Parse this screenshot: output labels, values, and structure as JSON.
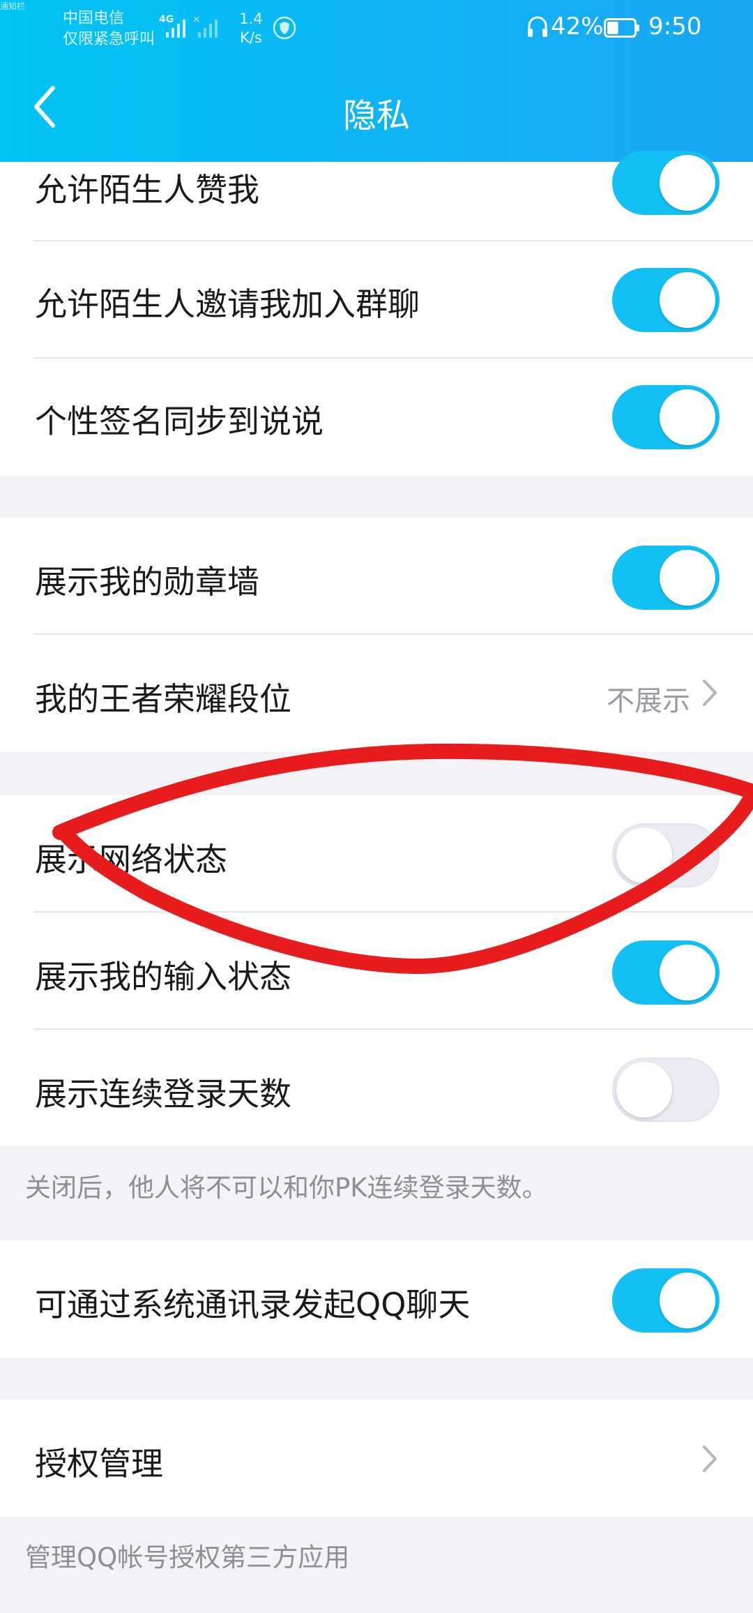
{
  "status_bar": {
    "tiny_label": "通知栏",
    "carrier_line1": "中国电信",
    "carrier_line2": "仅限紧急呼叫",
    "network_type": "4G",
    "speed_value": "1.4",
    "speed_unit": "K/s",
    "battery_percent": "42%",
    "battery_level": 0.42,
    "time": "9:50"
  },
  "header": {
    "title": "隐私",
    "back_icon": "chevron-left-icon"
  },
  "settings": {
    "allow_stranger_like": {
      "label": "允许陌生人赞我",
      "enabled": true
    },
    "allow_stranger_invite": {
      "label": "允许陌生人邀请我加入群聊",
      "enabled": true
    },
    "sync_signature": {
      "label": "个性签名同步到说说",
      "enabled": true
    },
    "show_medal_wall": {
      "label": "展示我的勋章墙",
      "enabled": true
    },
    "honor_of_kings_rank": {
      "label": "我的王者荣耀段位",
      "value": "不展示"
    },
    "show_network_status": {
      "label": "展示网络状态",
      "enabled": false
    },
    "show_typing_status": {
      "label": "展示我的输入状态",
      "enabled": true
    },
    "show_login_days": {
      "label": "展示连续登录天数",
      "enabled": false
    },
    "login_days_note": "关闭后，他人将不可以和你PK连续登录天数。",
    "contacts_chat": {
      "label": "可通过系统通讯录发起QQ聊天",
      "enabled": true
    },
    "authorization": {
      "label": "授权管理"
    },
    "authorization_note": "管理QQ帐号授权第三方应用"
  },
  "colors": {
    "header_start": "#00c4f5",
    "header_end": "#1aa6f3",
    "toggle_on": "#12c0f6",
    "toggle_off": "#eaebf3",
    "annotation": "#e81c1c"
  }
}
